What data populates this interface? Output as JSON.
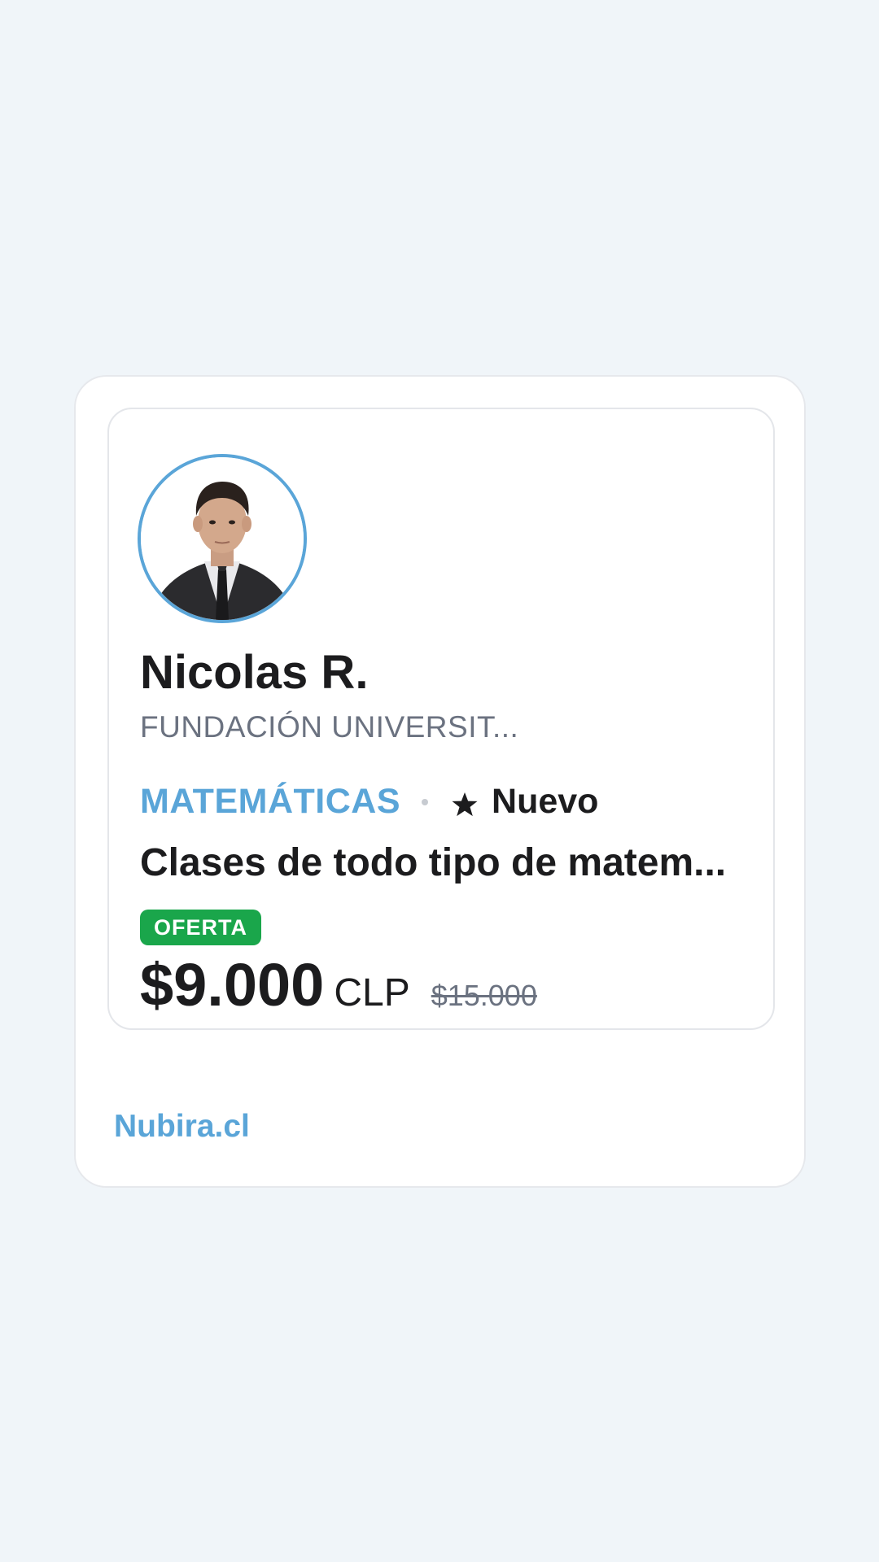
{
  "tutor": {
    "name": "Nicolas R.",
    "institution": "FUNDACIÓN UNIVERSIT...",
    "avatar_alt": "Tutor profile photo"
  },
  "listing": {
    "subject": "MATEMÁTICAS",
    "status": "Nuevo",
    "title": "Clases de todo tipo de matem...",
    "offer_label": "OFERTA",
    "price": "$9.000",
    "currency": "CLP",
    "original_price": "$15.000"
  },
  "footer": {
    "brand": "Nubira.cl"
  },
  "colors": {
    "accent": "#5aa5d8",
    "offer": "#1aa64b",
    "text": "#1c1c1e",
    "muted": "#6b7280",
    "background": "#f0f5f9"
  },
  "icons": {
    "status": "star-icon",
    "separator": "dot-separator"
  }
}
